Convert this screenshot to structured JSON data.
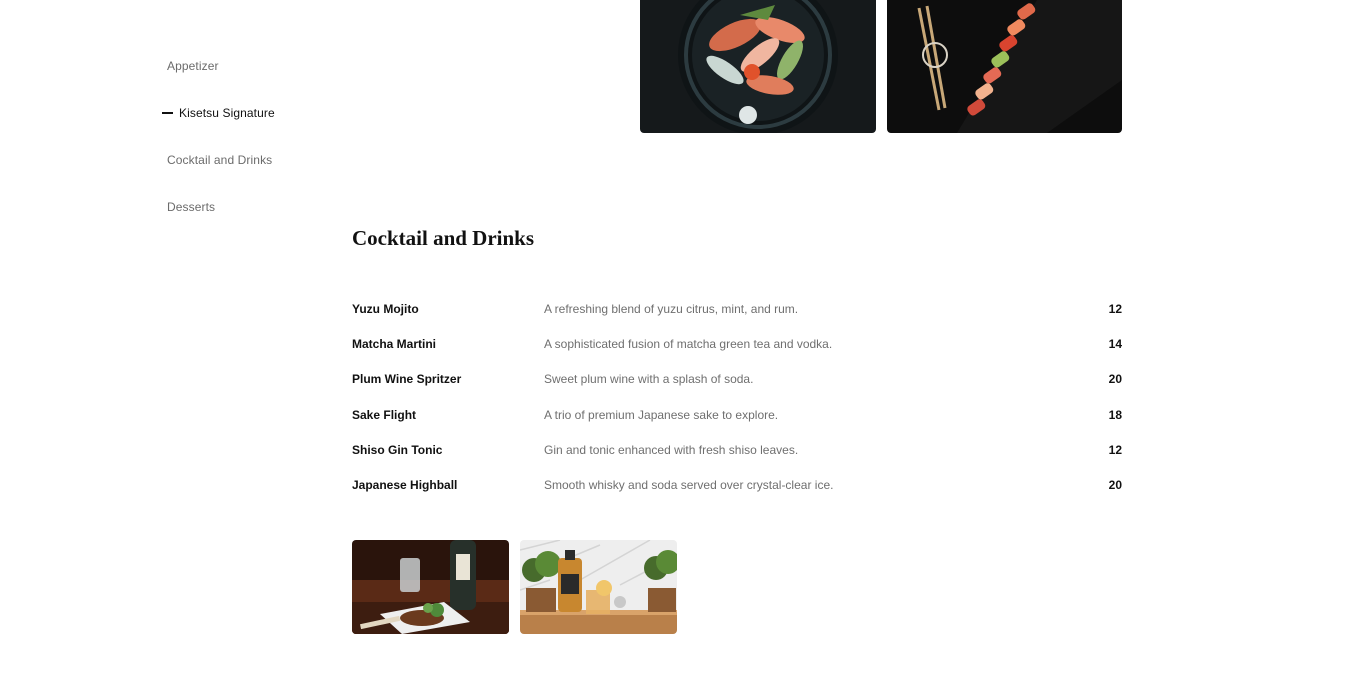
{
  "sidebar": {
    "items": [
      {
        "label": "Appetizer",
        "active": false
      },
      {
        "label": "Kisetsu Signature",
        "active": true
      },
      {
        "label": "Cocktail and Drinks",
        "active": false
      },
      {
        "label": "Desserts",
        "active": false
      }
    ]
  },
  "section": {
    "title": "Cocktail and Drinks",
    "items": [
      {
        "name": "Yuzu Mojito",
        "description": "A refreshing blend of yuzu citrus, mint, and rum.",
        "price": "12"
      },
      {
        "name": "Matcha Martini",
        "description": "A sophisticated fusion of matcha green tea and vodka.",
        "price": "14"
      },
      {
        "name": "Plum Wine Spritzer",
        "description": "Sweet plum wine with a splash of soda.",
        "price": "20"
      },
      {
        "name": "Sake Flight",
        "description": "A trio of premium Japanese sake to explore.",
        "price": "18"
      },
      {
        "name": "Shiso Gin Tonic",
        "description": "Gin and tonic enhanced with fresh shiso leaves.",
        "price": "12"
      },
      {
        "name": "Japanese Highball",
        "description": "Smooth whisky and soda served over crystal-clear ice.",
        "price": "20"
      }
    ]
  },
  "colors": {
    "text": "#111111",
    "muted": "#6b6b6b",
    "background": "#ffffff"
  }
}
